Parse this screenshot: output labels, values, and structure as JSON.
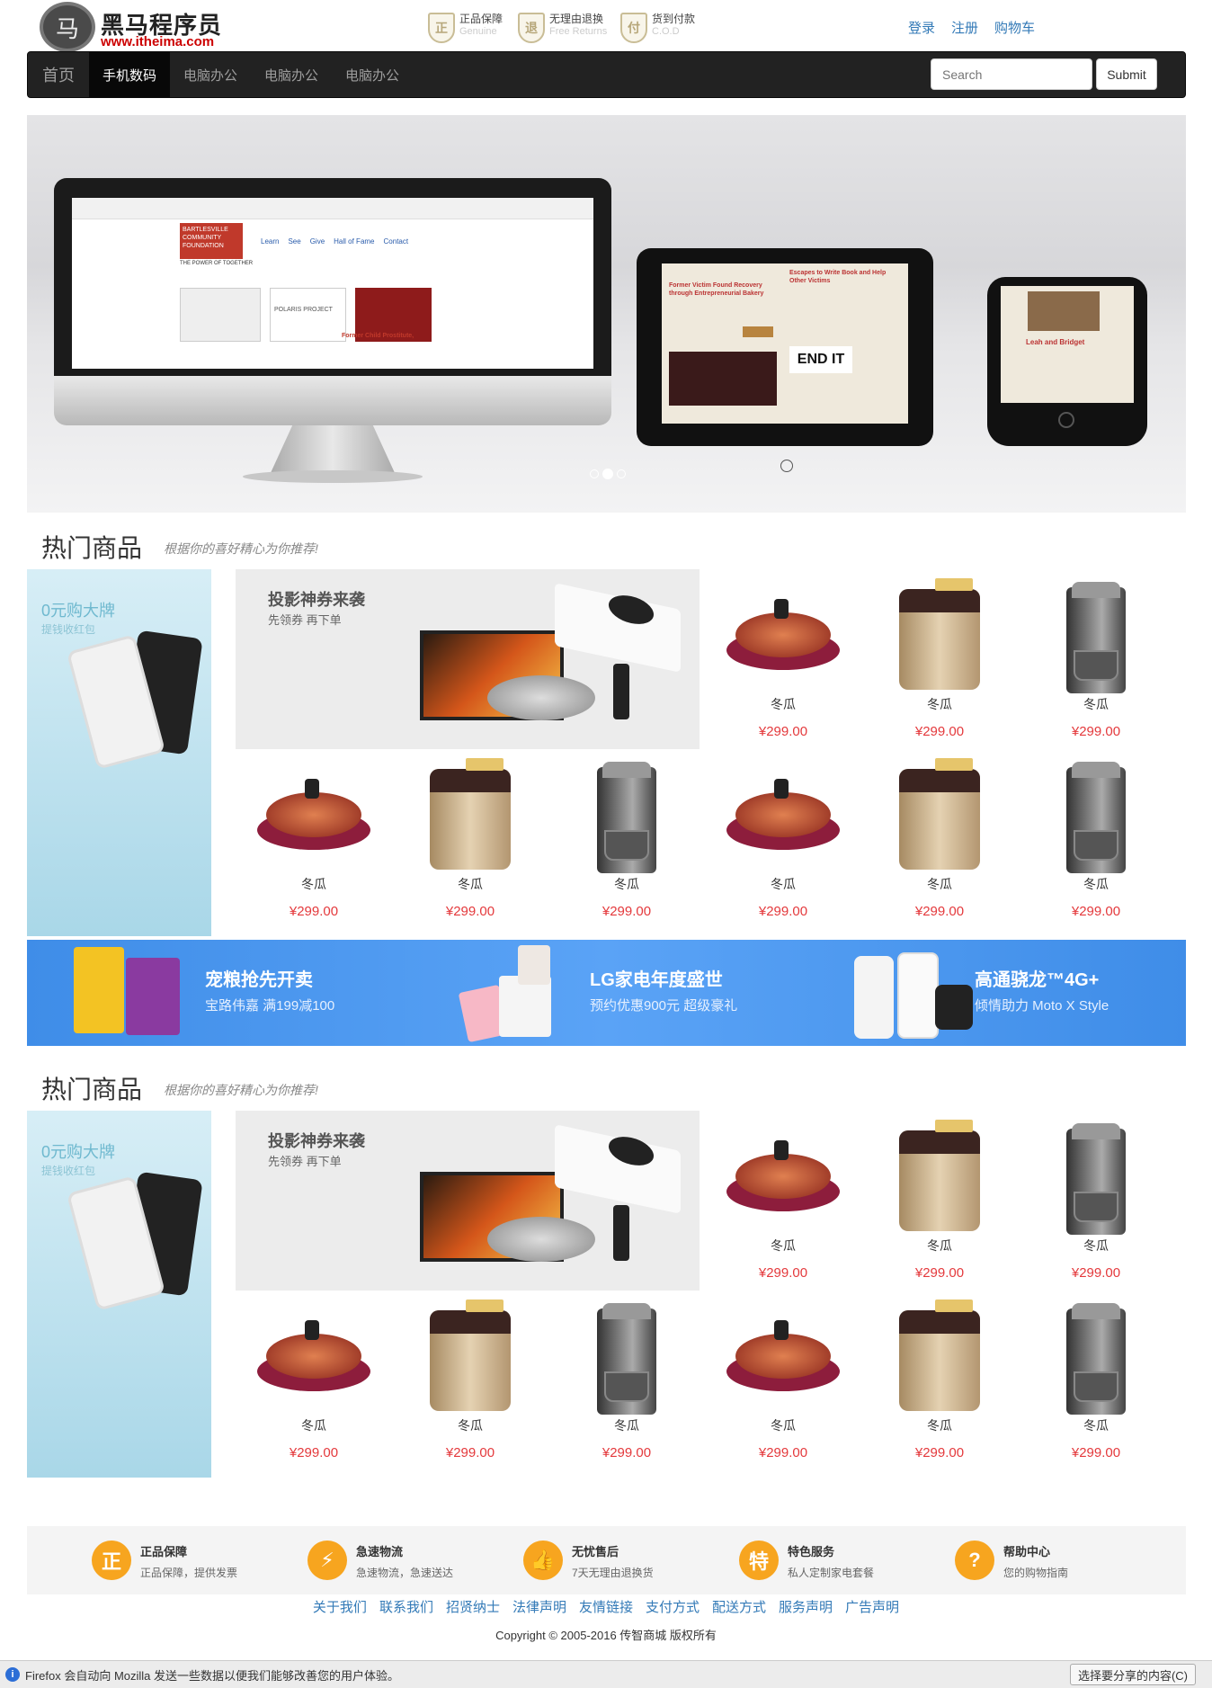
{
  "header": {
    "logo_glyph": "马",
    "logo_name": "黑马程序员",
    "logo_url": "www.itheima.com",
    "promos": [
      {
        "icon": "genuine-shield-icon",
        "glyph": "正",
        "title": "正品保障",
        "sub": "Genuine"
      },
      {
        "icon": "return-shield-icon",
        "glyph": "退",
        "title": "无理由退换",
        "sub": "Free Returns"
      },
      {
        "icon": "cod-shield-icon",
        "glyph": "付",
        "title": "货到付款",
        "sub": "C.O.D"
      }
    ],
    "links": [
      "登录",
      "注册",
      "购物车"
    ]
  },
  "nav": {
    "items": [
      "首页",
      "手机数码",
      "电脑办公",
      "电脑办公",
      "电脑办公"
    ],
    "active_index": 1,
    "search_placeholder": "Search",
    "submit_label": "Submit"
  },
  "carousel": {
    "slide_count": 3,
    "active_slide": 1,
    "screen_texts": {
      "monitor_org": "BARTLESVILLE COMMUNITY FOUNDATION",
      "monitor_tag": "THE POWER OF TOGETHER",
      "monitor_menu": [
        "Learn",
        "See",
        "Give",
        "Hall of Fame",
        "Contact"
      ],
      "monitor_polaris": "POLARIS PROJECT",
      "monitor_story": "Former Child Prostitute,",
      "tablet_left": "Former Victim Found Recovery through Entrepreneurial Bakery",
      "tablet_right": "Escapes to Write Book and Help Other Victims",
      "tablet_endit": "END IT",
      "phone_title": "Leah and Bridget"
    }
  },
  "sections": [
    {
      "title": "热门商品",
      "subtitle": "根据你的喜好精心为你推荐!",
      "big_ad": {
        "title": "0元购大牌",
        "sub": "提钱收红包"
      },
      "mid_ad": {
        "title": "投影神券来袭",
        "sub": "先领券 再下单"
      },
      "products": [
        {
          "kind": "pan",
          "name": "冬瓜",
          "price": "¥299.00"
        },
        {
          "kind": "breadmaker",
          "name": "冬瓜",
          "price": "¥299.00"
        },
        {
          "kind": "coffee",
          "name": "冬瓜",
          "price": "¥299.00"
        },
        {
          "kind": "pan",
          "name": "冬瓜",
          "price": "¥299.00"
        },
        {
          "kind": "breadmaker",
          "name": "冬瓜",
          "price": "¥299.00"
        },
        {
          "kind": "coffee",
          "name": "冬瓜",
          "price": "¥299.00"
        },
        {
          "kind": "pan",
          "name": "冬瓜",
          "price": "¥299.00"
        },
        {
          "kind": "breadmaker",
          "name": "冬瓜",
          "price": "¥299.00"
        },
        {
          "kind": "coffee",
          "name": "冬瓜",
          "price": "¥299.00"
        }
      ]
    },
    {
      "title": "热门商品",
      "subtitle": "根据你的喜好精心为你推荐!",
      "big_ad": {
        "title": "0元购大牌",
        "sub": "提钱收红包"
      },
      "mid_ad": {
        "title": "投影神券来袭",
        "sub": "先领券 再下单"
      },
      "products": [
        {
          "kind": "pan",
          "name": "冬瓜",
          "price": "¥299.00"
        },
        {
          "kind": "breadmaker",
          "name": "冬瓜",
          "price": "¥299.00"
        },
        {
          "kind": "coffee",
          "name": "冬瓜",
          "price": "¥299.00"
        },
        {
          "kind": "pan",
          "name": "冬瓜",
          "price": "¥299.00"
        },
        {
          "kind": "breadmaker",
          "name": "冬瓜",
          "price": "¥299.00"
        },
        {
          "kind": "coffee",
          "name": "冬瓜",
          "price": "¥299.00"
        },
        {
          "kind": "pan",
          "name": "冬瓜",
          "price": "¥299.00"
        },
        {
          "kind": "breadmaker",
          "name": "冬瓜",
          "price": "¥299.00"
        },
        {
          "kind": "coffee",
          "name": "冬瓜",
          "price": "¥299.00"
        }
      ]
    }
  ],
  "banner": {
    "items": [
      {
        "title": "宠粮抢先开卖",
        "sub": "宝路伟嘉  满199减100"
      },
      {
        "title": "LG家电年度盛世",
        "sub": "预约优惠900元  超级豪礼"
      },
      {
        "title": "高通骁龙™4G+",
        "sub": "倾情助力  Moto X Style"
      }
    ]
  },
  "services": [
    {
      "icon": "genuine-icon",
      "glyph": "正",
      "title": "正品保障",
      "desc": "正品保障，提供发票"
    },
    {
      "icon": "lightning-icon",
      "glyph": "⚡",
      "title": "急速物流",
      "desc": "急速物流，急速送达"
    },
    {
      "icon": "thumbs-up-icon",
      "glyph": "👍",
      "title": "无忧售后",
      "desc": "7天无理由退换货"
    },
    {
      "icon": "special-icon",
      "glyph": "特",
      "title": "特色服务",
      "desc": "私人定制家电套餐"
    },
    {
      "icon": "question-icon",
      "glyph": "?",
      "title": "帮助中心",
      "desc": "您的购物指南"
    }
  ],
  "footer": {
    "links": [
      "关于我们",
      "联系我们",
      "招贤纳士",
      "法律声明",
      "友情链接",
      "支付方式",
      "配送方式",
      "服务声明",
      "广告声明"
    ],
    "copyright": "Copyright © 2005-2016 传智商城 版权所有"
  },
  "statusbar": {
    "info_glyph": "i",
    "message": "Firefox 会自动向 Mozilla 发送一些数据以便我们能够改善您的用户体验。",
    "button": "选择要分享的内容(C)"
  },
  "colors": {
    "price": "#e4393c",
    "link": "#337ab7",
    "nav_bg": "#222222",
    "service_icon": "#f7a51f",
    "banner": "#4a97ef"
  }
}
